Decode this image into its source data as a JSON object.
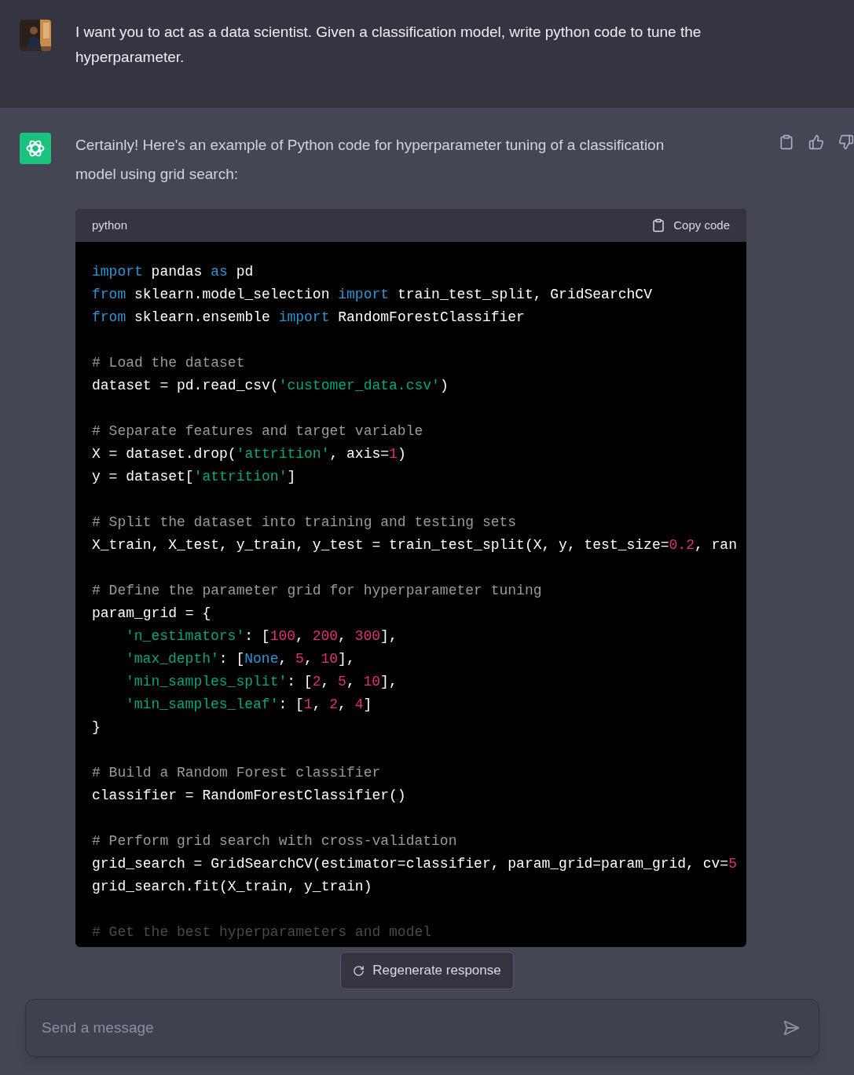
{
  "user_message": {
    "text": "I want you to act as a data scientist. Given a classification model, write python code to tune the hyperparameter."
  },
  "assistant_message": {
    "text": "Certainly! Here's an example of Python code for hyperparameter tuning of a classification model using grid search:",
    "code_block": {
      "language": "python",
      "copy_label": "Copy code",
      "lines": [
        {
          "kind": "code",
          "tokens": [
            {
              "kind": "keyword",
              "text": "import"
            },
            {
              "kind": "plain",
              "text": " pandas "
            },
            {
              "kind": "keyword",
              "text": "as"
            },
            {
              "kind": "plain",
              "text": " pd"
            }
          ]
        },
        {
          "kind": "code",
          "tokens": [
            {
              "kind": "keyword",
              "text": "from"
            },
            {
              "kind": "plain",
              "text": " sklearn.model_selection "
            },
            {
              "kind": "keyword",
              "text": "import"
            },
            {
              "kind": "plain",
              "text": " train_test_split, GridSearchCV"
            }
          ]
        },
        {
          "kind": "code",
          "tokens": [
            {
              "kind": "keyword",
              "text": "from"
            },
            {
              "kind": "plain",
              "text": " sklearn.ensemble "
            },
            {
              "kind": "keyword",
              "text": "import"
            },
            {
              "kind": "plain",
              "text": " RandomForestClassifier"
            }
          ]
        },
        {
          "kind": "blank"
        },
        {
          "kind": "code",
          "tokens": [
            {
              "kind": "comment",
              "text": "# Load the dataset"
            }
          ]
        },
        {
          "kind": "code",
          "tokens": [
            {
              "kind": "plain",
              "text": "dataset = pd.read_csv("
            },
            {
              "kind": "string",
              "text": "'customer_data.csv'"
            },
            {
              "kind": "plain",
              "text": ")"
            }
          ]
        },
        {
          "kind": "blank"
        },
        {
          "kind": "code",
          "tokens": [
            {
              "kind": "comment",
              "text": "# Separate features and target variable"
            }
          ]
        },
        {
          "kind": "code",
          "tokens": [
            {
              "kind": "plain",
              "text": "X = dataset.drop("
            },
            {
              "kind": "string",
              "text": "'attrition'"
            },
            {
              "kind": "plain",
              "text": ", axis="
            },
            {
              "kind": "number",
              "text": "1"
            },
            {
              "kind": "plain",
              "text": ")"
            }
          ]
        },
        {
          "kind": "code",
          "tokens": [
            {
              "kind": "plain",
              "text": "y = dataset["
            },
            {
              "kind": "string",
              "text": "'attrition'"
            },
            {
              "kind": "plain",
              "text": "]"
            }
          ]
        },
        {
          "kind": "blank"
        },
        {
          "kind": "code",
          "tokens": [
            {
              "kind": "comment",
              "text": "# Split the dataset into training and testing sets"
            }
          ]
        },
        {
          "kind": "code",
          "tokens": [
            {
              "kind": "plain",
              "text": "X_train, X_test, y_train, y_test = train_test_split(X, y, test_size="
            },
            {
              "kind": "number",
              "text": "0.2"
            },
            {
              "kind": "plain",
              "text": ", ran"
            }
          ]
        },
        {
          "kind": "blank"
        },
        {
          "kind": "code",
          "tokens": [
            {
              "kind": "comment",
              "text": "# Define the parameter grid for hyperparameter tuning"
            }
          ]
        },
        {
          "kind": "code",
          "tokens": [
            {
              "kind": "plain",
              "text": "param_grid = {"
            }
          ]
        },
        {
          "kind": "code",
          "indented": true,
          "tokens": [
            {
              "kind": "string",
              "text": "'n_estimators'"
            },
            {
              "kind": "plain",
              "text": ": ["
            },
            {
              "kind": "number",
              "text": "100"
            },
            {
              "kind": "plain",
              "text": ", "
            },
            {
              "kind": "number",
              "text": "200"
            },
            {
              "kind": "plain",
              "text": ", "
            },
            {
              "kind": "number",
              "text": "300"
            },
            {
              "kind": "plain",
              "text": "],"
            }
          ]
        },
        {
          "kind": "code",
          "indented": true,
          "tokens": [
            {
              "kind": "string",
              "text": "'max_depth'"
            },
            {
              "kind": "plain",
              "text": ": ["
            },
            {
              "kind": "keyword",
              "text": "None"
            },
            {
              "kind": "plain",
              "text": ", "
            },
            {
              "kind": "number",
              "text": "5"
            },
            {
              "kind": "plain",
              "text": ", "
            },
            {
              "kind": "number",
              "text": "10"
            },
            {
              "kind": "plain",
              "text": "],"
            }
          ]
        },
        {
          "kind": "code",
          "indented": true,
          "tokens": [
            {
              "kind": "string",
              "text": "'min_samples_split'"
            },
            {
              "kind": "plain",
              "text": ": ["
            },
            {
              "kind": "number",
              "text": "2"
            },
            {
              "kind": "plain",
              "text": ", "
            },
            {
              "kind": "number",
              "text": "5"
            },
            {
              "kind": "plain",
              "text": ", "
            },
            {
              "kind": "number",
              "text": "10"
            },
            {
              "kind": "plain",
              "text": "],"
            }
          ]
        },
        {
          "kind": "code",
          "indented": true,
          "tokens": [
            {
              "kind": "string",
              "text": "'min_samples_leaf'"
            },
            {
              "kind": "plain",
              "text": ": ["
            },
            {
              "kind": "number",
              "text": "1"
            },
            {
              "kind": "plain",
              "text": ", "
            },
            {
              "kind": "number",
              "text": "2"
            },
            {
              "kind": "plain",
              "text": ", "
            },
            {
              "kind": "number",
              "text": "4"
            },
            {
              "kind": "plain",
              "text": "]"
            }
          ]
        },
        {
          "kind": "code",
          "tokens": [
            {
              "kind": "plain",
              "text": "}"
            }
          ]
        },
        {
          "kind": "blank"
        },
        {
          "kind": "code",
          "tokens": [
            {
              "kind": "comment",
              "text": "# Build a Random Forest classifier"
            }
          ]
        },
        {
          "kind": "code",
          "tokens": [
            {
              "kind": "plain",
              "text": "classifier = RandomForestClassifier()"
            }
          ]
        },
        {
          "kind": "blank"
        },
        {
          "kind": "code",
          "tokens": [
            {
              "kind": "comment",
              "text": "# Perform grid search with cross-validation"
            }
          ]
        },
        {
          "kind": "code",
          "tokens": [
            {
              "kind": "plain",
              "text": "grid_search = GridSearchCV(estimator=classifier, param_grid=param_grid, cv="
            },
            {
              "kind": "number",
              "text": "5"
            }
          ]
        },
        {
          "kind": "code",
          "tokens": [
            {
              "kind": "plain",
              "text": "grid_search.fit(X_train, y_train)"
            }
          ]
        },
        {
          "kind": "blank"
        },
        {
          "kind": "code",
          "tokens": [
            {
              "kind": "faded",
              "text": "# Get the best hyperparameters and model"
            }
          ]
        }
      ]
    }
  },
  "regenerate_button": {
    "label": "Regenerate response"
  },
  "composer": {
    "placeholder": "Send a message"
  }
}
